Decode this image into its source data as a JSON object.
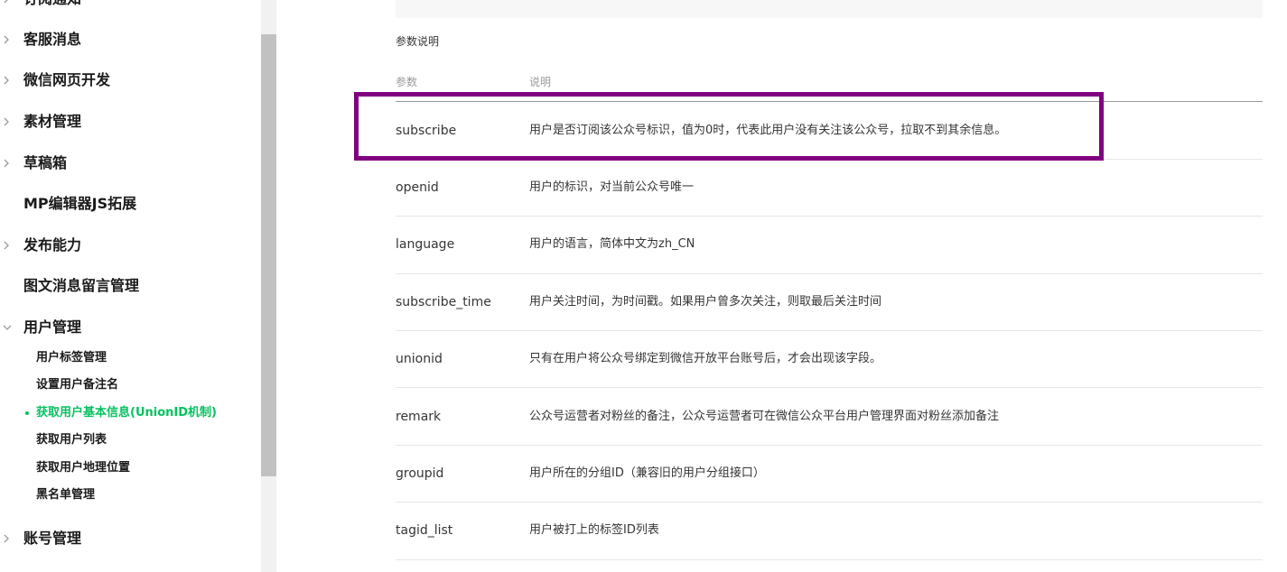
{
  "sidebar": {
    "items": [
      {
        "label": "订阅通知",
        "chevron": "right"
      },
      {
        "label": "客服消息",
        "chevron": "right"
      },
      {
        "label": "微信网页开发",
        "chevron": "right"
      },
      {
        "label": "素材管理",
        "chevron": "right"
      },
      {
        "label": "草稿箱",
        "chevron": "right"
      },
      {
        "label": "MP编辑器JS拓展",
        "chevron": "none"
      },
      {
        "label": "发布能力",
        "chevron": "right"
      },
      {
        "label": "图文消息留言管理",
        "chevron": "none"
      },
      {
        "label": "用户管理",
        "chevron": "down"
      },
      {
        "label": "账号管理",
        "chevron": "right"
      }
    ],
    "user_management_children": [
      {
        "label": "用户标签管理",
        "active": false
      },
      {
        "label": "设置用户备注名",
        "active": false
      },
      {
        "label": "获取用户基本信息(UnionID机制)",
        "active": true
      },
      {
        "label": "获取用户列表",
        "active": false
      },
      {
        "label": "获取用户地理位置",
        "active": false
      },
      {
        "label": "黑名单管理",
        "active": false
      }
    ],
    "accent_color": "#07c160"
  },
  "main": {
    "section_title": "参数说明",
    "table": {
      "headers": [
        "参数",
        "说明"
      ],
      "rows": [
        {
          "param": "subscribe",
          "desc": "用户是否订阅该公众号标识，值为0时，代表此用户没有关注该公众号，拉取不到其余信息。"
        },
        {
          "param": "openid",
          "desc": "用户的标识，对当前公众号唯一"
        },
        {
          "param": "language",
          "desc": "用户的语言，简体中文为zh_CN"
        },
        {
          "param": "subscribe_time",
          "desc": "用户关注时间，为时间戳。如果用户曾多次关注，则取最后关注时间"
        },
        {
          "param": "unionid",
          "desc": "只有在用户将公众号绑定到微信开放平台账号后，才会出现该字段。"
        },
        {
          "param": "remark",
          "desc": "公众号运营者对粉丝的备注，公众号运营者可在微信公众平台用户管理界面对粉丝添加备注"
        },
        {
          "param": "groupid",
          "desc": "用户所在的分组ID（兼容旧的用户分组接口）"
        },
        {
          "param": "tagid_list",
          "desc": "用户被打上的标签ID列表"
        }
      ]
    },
    "highlight_color": "#800080"
  }
}
